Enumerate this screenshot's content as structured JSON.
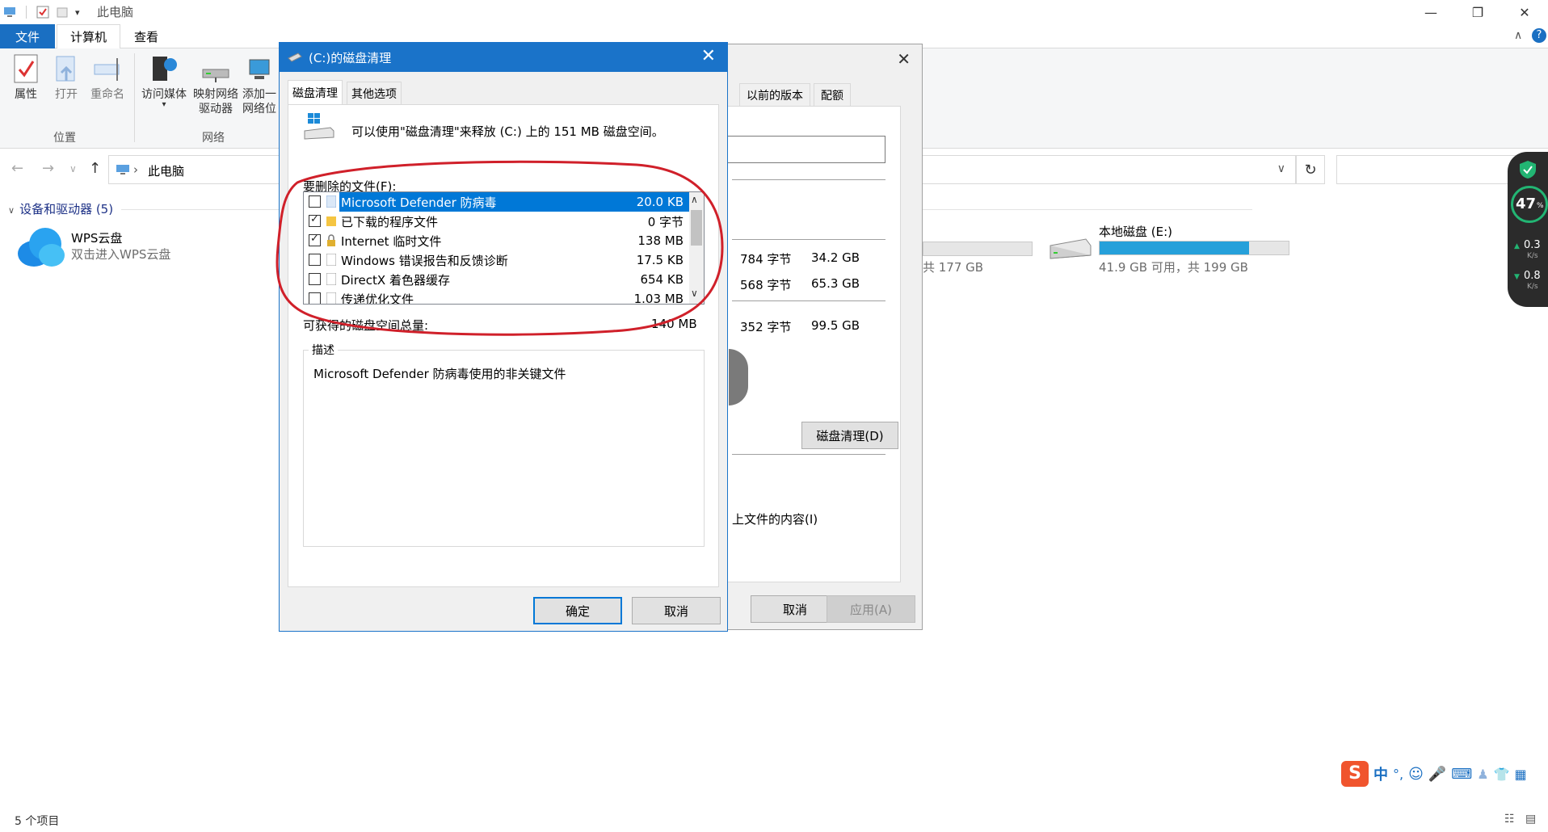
{
  "explorer": {
    "title": "此电脑",
    "tabs": {
      "file": "文件",
      "computer": "计算机",
      "view": "查看"
    },
    "ribbon": {
      "properties": "属性",
      "open": "打开",
      "rename": "重命名",
      "access_media": "访问媒体",
      "map_drive_1": "映射网络",
      "map_drive_2": "驱动器",
      "add_network_1": "添加一",
      "add_network_2": "网络位",
      "group_location": "位置",
      "group_network": "网络"
    },
    "address": {
      "crumb": "此电脑"
    },
    "section_header": "设备和驱动器 (5)",
    "wps": {
      "name": "WPS云盘",
      "sub": "双击进入WPS云盘"
    },
    "drive_e": {
      "name": "本地磁盘 (E:)",
      "info": "41.9 GB 可用，共 199 GB",
      "used_fraction": 0.79
    },
    "partial_drive_info": "共 177 GB",
    "status_count": "5 个项目"
  },
  "properties_dialog": {
    "tabs": {
      "previous": "以前的版本",
      "quota": "配额"
    },
    "rows": [
      {
        "bytes": "784 字节",
        "size": "34.2 GB"
      },
      {
        "bytes": "568 字节",
        "size": "65.3 GB"
      },
      {
        "bytes": "352 字节",
        "size": "99.5 GB"
      }
    ],
    "disk_cleanup_button": "磁盘清理(D)",
    "index_text": "上文件的内容(I)",
    "cancel": "取消",
    "apply": "应用(A)"
  },
  "cleanup_dialog": {
    "title": "(C:)的磁盘清理",
    "tabs": {
      "cleanup": "磁盘清理",
      "more": "其他选项"
    },
    "intro": "可以使用\"磁盘清理\"来释放 (C:) 上的 151 MB 磁盘空间。",
    "files_label": "要删除的文件(F):",
    "files": [
      {
        "name": "Microsoft Defender 防病毒",
        "size": "20.0 KB",
        "checked": false,
        "selected": true
      },
      {
        "name": "已下载的程序文件",
        "size": "0 字节",
        "checked": true,
        "selected": false
      },
      {
        "name": "Internet 临时文件",
        "size": "138 MB",
        "checked": true,
        "selected": false
      },
      {
        "name": "Windows 错误报告和反馈诊断",
        "size": "17.5 KB",
        "checked": false,
        "selected": false
      },
      {
        "name": "DirectX 着色器缓存",
        "size": "654 KB",
        "checked": false,
        "selected": false
      },
      {
        "name": "传递优化文件",
        "size": "1.03 MB",
        "checked": false,
        "selected": false
      }
    ],
    "total_label": "可获得的磁盘空间总量:",
    "total_value": "140 MB",
    "description_legend": "描述",
    "description_text": "Microsoft Defender 防病毒使用的非关键文件",
    "ok": "确定",
    "cancel": "取消"
  },
  "net_widget": {
    "percent": "47",
    "percent_unit": "%",
    "up": "0.3",
    "down": "0.8",
    "unit": "K/s"
  },
  "ime": {
    "lang": "中"
  },
  "colors": {
    "accent": "#1a73c9",
    "selection": "#0078d7",
    "annotation": "#d0202a",
    "drive_bar": "#26a0da"
  }
}
